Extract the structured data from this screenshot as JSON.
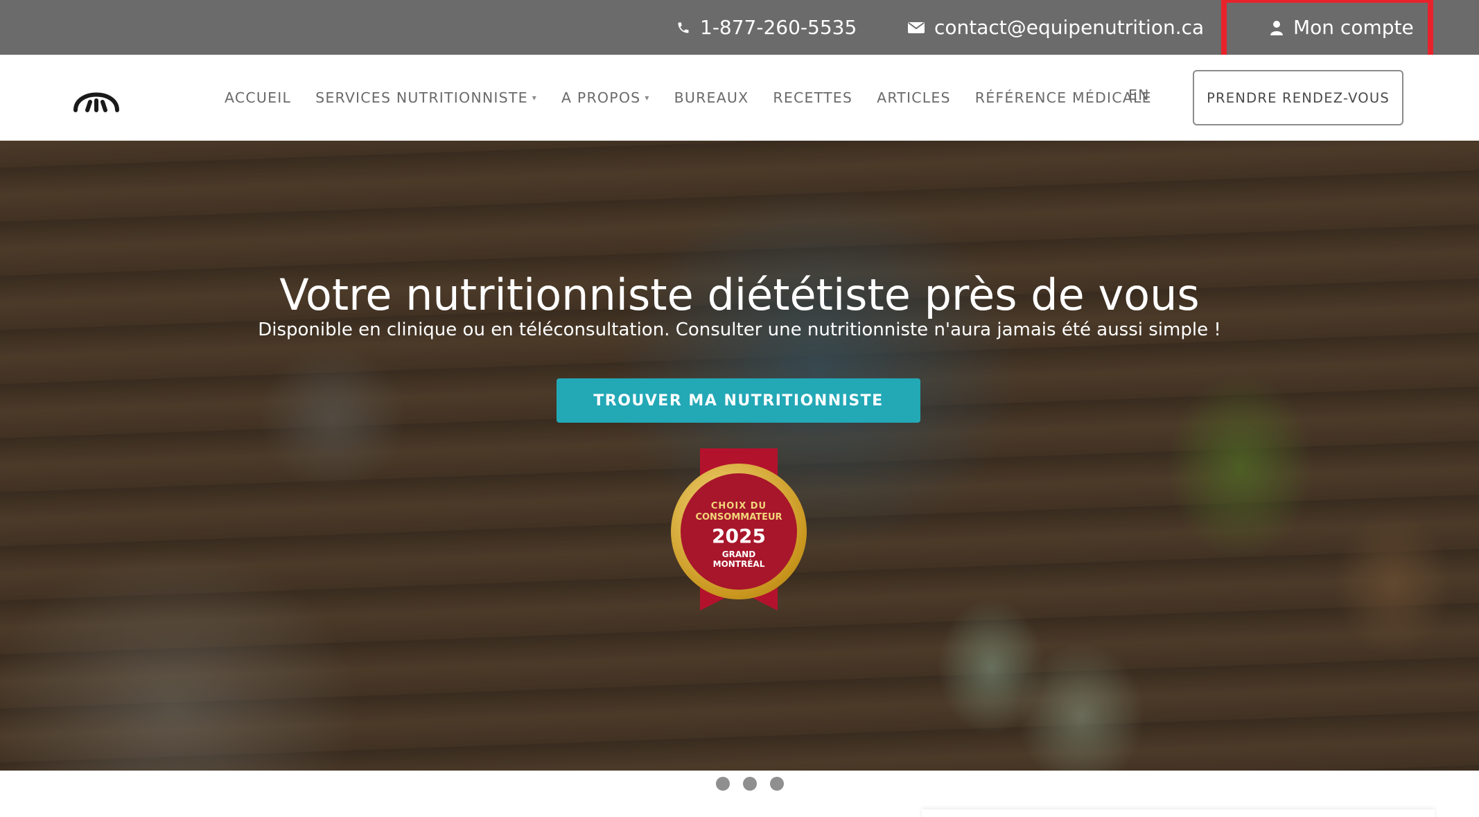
{
  "topbar": {
    "phone": "1-877-260-5535",
    "email": "contact@equipenutrition.ca",
    "account": "Mon compte",
    "background": "#6b6b6b",
    "highlight_color": "#e8222b"
  },
  "nav": {
    "items": [
      {
        "label": "ACCUEIL",
        "has_dropdown": false
      },
      {
        "label": "SERVICES NUTRITIONNISTE",
        "has_dropdown": true
      },
      {
        "label": "A PROPOS",
        "has_dropdown": true
      },
      {
        "label": "BUREAUX",
        "has_dropdown": false
      },
      {
        "label": "RECETTES",
        "has_dropdown": false
      },
      {
        "label": "ARTICLES",
        "has_dropdown": false
      },
      {
        "label": "RÉFÉRENCE MÉDICALE",
        "has_dropdown": false
      }
    ],
    "language": "EN",
    "cta": "PRENDRE RENDEZ-VOUS"
  },
  "hero": {
    "title": "Votre nutritionniste diététiste près de vous",
    "subtitle": "Disponible en clinique ou en téléconsultation. Consulter une nutritionniste n'aura jamais été aussi simple !",
    "button": "TROUVER MA NUTRITIONNISTE",
    "button_color": "#23a8b6",
    "badge": {
      "line1": "CHOIX DU",
      "line2": "CONSOMMATEUR",
      "year": "2025",
      "line3": "GRAND",
      "line4": "MONTRÉAL"
    }
  },
  "slider": {
    "dot_count": 3
  },
  "icons": [
    "phone-icon",
    "envelope-icon",
    "user-icon",
    "chevron-down-icon",
    "logo-icon"
  ]
}
